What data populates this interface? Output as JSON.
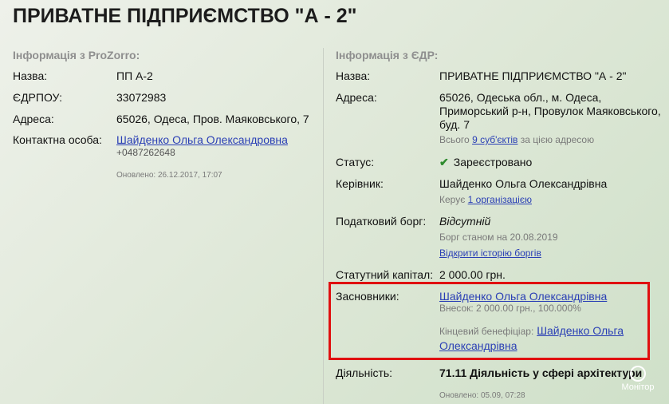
{
  "title": "ПРИВАТНЕ ПІДПРИЄМСТВО \"А - 2\"",
  "prozorro": {
    "heading": "Інформація з ProZorro:",
    "name_label": "Назва:",
    "name_value": "ПП А-2",
    "edrpou_label": "ЄДРПОУ:",
    "edrpou_value": "33072983",
    "address_label": "Адреса:",
    "address_value": "65026, Одеса, Пров. Маяковського, 7",
    "contact_label": "Контактна особа:",
    "contact_name": "Шайденко Ольга Олександровна",
    "contact_phone": "+0487262648",
    "updated": "Оновлено: 26.12.2017, 17:07"
  },
  "edr": {
    "heading": "Інформація з ЄДР:",
    "name_label": "Назва:",
    "name_value": "ПРИВАТНЕ ПІДПРИЄМСТВО \"А - 2\"",
    "address_label": "Адреса:",
    "address_value": "65026, Одеська обл., м. Одеса, Приморський р-н, Провулок Маяковського, буд. 7",
    "address_note_pre": "Всього",
    "address_note_link": "9 суб'єктів",
    "address_note_post": "за цією адресою",
    "status_label": "Статус:",
    "status_value": "Зареєстровано",
    "head_label": "Керівник:",
    "head_value": "Шайденко Ольга Олександрівна",
    "head_note_pre": "Керує",
    "head_note_link": "1 організацією",
    "debt_label": "Податковий борг:",
    "debt_value": "Відсутній",
    "debt_date": "Борг станом на 20.08.2019",
    "debt_history_link": "Відкрити історію боргів",
    "capital_label": "Статутний капітал:",
    "capital_value": "2 000.00 грн.",
    "founders_label": "Засновники:",
    "founder_name": "Шайденко Ольга Олександрівна",
    "founder_share": "Внесок: 2 000.00 грн., 100.000%",
    "beneficiary_label": "Кінцевий бенефіціар:",
    "beneficiary_name_1": "Шайденко Ольга",
    "beneficiary_name_2": "Олександрівна",
    "activity_label": "Діяльність:",
    "activity_value": "71.11 Діяльність у сфері архітектури",
    "updated": "Оновлено: 05.09, 07:28"
  },
  "watermark": "Монітор",
  "colors": {
    "link": "#2a3fb5",
    "highlight_border": "#e01010",
    "status_ok": "#2e8b2e"
  }
}
